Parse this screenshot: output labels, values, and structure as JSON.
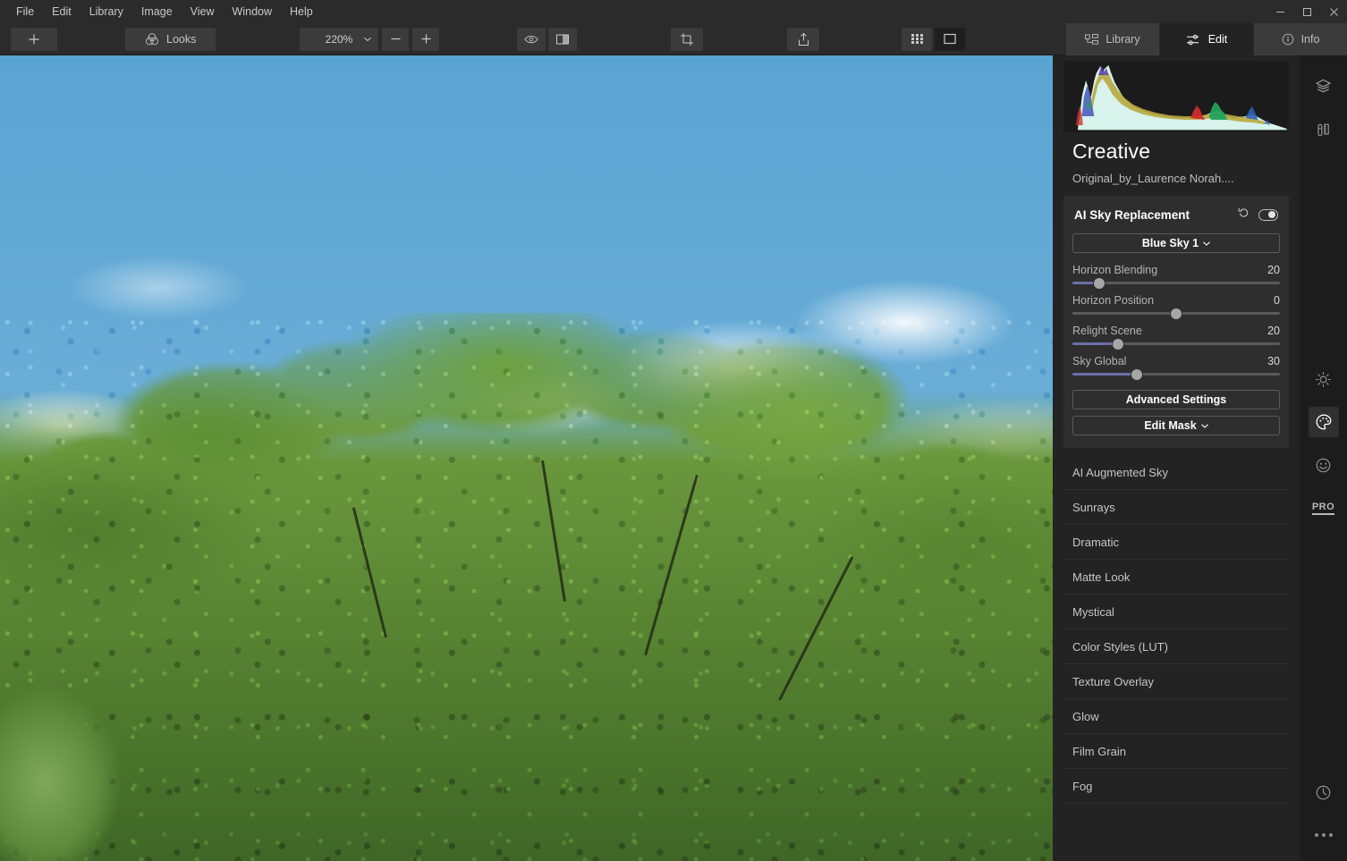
{
  "window": {
    "controls": [
      {
        "name": "minimize",
        "glyph": "minimize-icon"
      },
      {
        "name": "maximize",
        "glyph": "maximize-icon"
      },
      {
        "name": "close",
        "glyph": "close-icon"
      }
    ]
  },
  "menubar": {
    "items": [
      {
        "label": "File"
      },
      {
        "label": "Edit"
      },
      {
        "label": "Library"
      },
      {
        "label": "Image"
      },
      {
        "label": "View"
      },
      {
        "label": "Window"
      },
      {
        "label": "Help"
      }
    ]
  },
  "toolbar": {
    "add_label": "+",
    "add_icon": "plus-icon",
    "looks_label": "Looks",
    "looks_icon": "looks-rings-icon",
    "zoom_value": "220%",
    "zoom_caret_icon": "chevron-down-icon",
    "zoom_out_label": "−",
    "zoom_in_label": "+",
    "preview_icon": "eye-icon",
    "compare_icon": "compare-split-icon",
    "crop_icon": "crop-icon",
    "share_icon": "share-export-icon",
    "grid_icon": "grid-view-icon",
    "single_icon": "single-view-icon",
    "tabs": [
      {
        "label": "Library",
        "icon": "library-icon",
        "active": false
      },
      {
        "label": "Edit",
        "icon": "sliders-icon",
        "active": true
      },
      {
        "label": "Info",
        "icon": "info-circle-icon",
        "active": false
      }
    ]
  },
  "panel": {
    "title": "Creative",
    "subtitle": "Original_by_Laurence Norah....",
    "histogram_label": "histogram"
  },
  "sky_card": {
    "title": "AI Sky Replacement",
    "reset_icon": "reset-arrow-icon",
    "toggle_icon": "visibility-toggle-icon",
    "preset_label": "Blue Sky 1",
    "preset_caret_icon": "chevron-down-icon",
    "sliders": [
      {
        "label": "Horizon Blending",
        "value": "20",
        "pct": 13
      },
      {
        "label": "Horizon Position",
        "value": "0",
        "pct": 50
      },
      {
        "label": "Relight Scene",
        "value": "20",
        "pct": 22
      },
      {
        "label": "Sky Global",
        "value": "30",
        "pct": 31
      }
    ],
    "advanced_label": "Advanced Settings",
    "edit_mask_label": "Edit Mask",
    "edit_mask_caret_icon": "chevron-down-icon"
  },
  "tool_list": {
    "items": [
      {
        "label": "AI Augmented Sky"
      },
      {
        "label": "Sunrays"
      },
      {
        "label": "Dramatic"
      },
      {
        "label": "Matte Look"
      },
      {
        "label": "Mystical"
      },
      {
        "label": "Color Styles (LUT)"
      },
      {
        "label": "Texture Overlay"
      },
      {
        "label": "Glow"
      },
      {
        "label": "Film Grain"
      },
      {
        "label": "Fog"
      }
    ]
  },
  "rail": {
    "top": [
      {
        "name": "layers",
        "icon": "layers-icon",
        "active": false
      },
      {
        "name": "tools",
        "icon": "pen-ruler-icon",
        "active": false
      }
    ],
    "middle": [
      {
        "name": "essentials",
        "icon": "sun-icon",
        "active": false
      },
      {
        "name": "creative",
        "icon": "palette-icon",
        "active": true
      },
      {
        "name": "portrait",
        "icon": "smiley-icon",
        "active": false
      },
      {
        "name": "pro",
        "icon": "pro-badge",
        "label": "PRO",
        "active": false
      }
    ],
    "bottom": [
      {
        "name": "history",
        "icon": "clock-icon",
        "active": false
      },
      {
        "name": "more",
        "icon": "more-dots-icon",
        "active": false
      }
    ]
  },
  "colors": {
    "accent": "#6b6fa8",
    "panel_bg": "#232323",
    "card_bg": "#2e2e2e",
    "toolbar_bg": "#2b2b2b",
    "rail_bg": "#1c1c1c",
    "sky_blue": "#66abd6",
    "foliage_green": "#5f8c36"
  }
}
